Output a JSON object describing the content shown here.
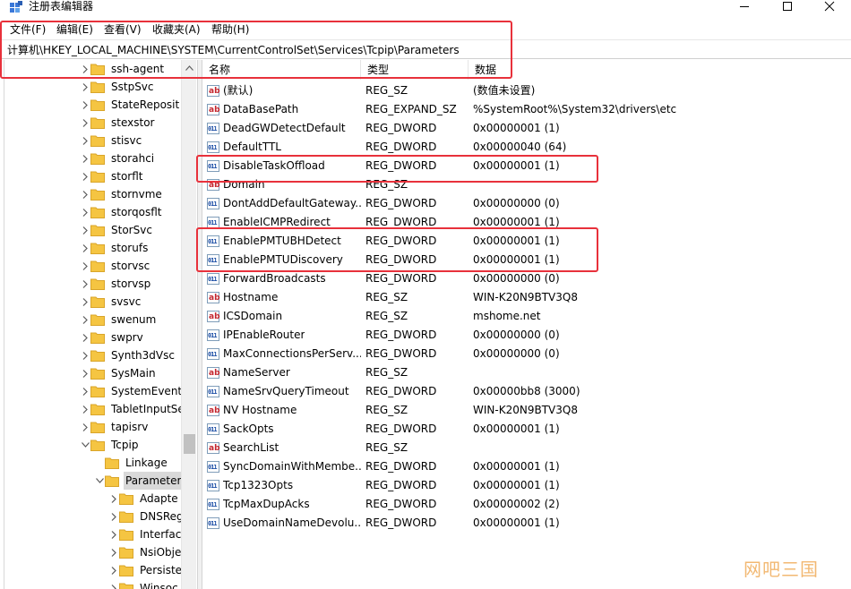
{
  "window": {
    "title": "注册表编辑器",
    "controls": [
      "minimize-icon",
      "maximize-icon",
      "close-icon"
    ]
  },
  "menu": [
    {
      "label": "文件(F)"
    },
    {
      "label": "编辑(E)"
    },
    {
      "label": "查看(V)"
    },
    {
      "label": "收藏夹(A)"
    },
    {
      "label": "帮助(H)"
    }
  ],
  "address": {
    "path": "计算机\\HKEY_LOCAL_MACHINE\\SYSTEM\\CurrentControlSet\\Services\\Tcpip\\Parameters"
  },
  "tree": {
    "items": [
      {
        "label": "ssh-agent"
      },
      {
        "label": "SstpSvc"
      },
      {
        "label": "StateReposit"
      },
      {
        "label": "stexstor"
      },
      {
        "label": "stisvc"
      },
      {
        "label": "storahci"
      },
      {
        "label": "storflt"
      },
      {
        "label": "stornvme"
      },
      {
        "label": "storqosflt"
      },
      {
        "label": "StorSvc"
      },
      {
        "label": "storufs"
      },
      {
        "label": "storvsc"
      },
      {
        "label": "storvsp"
      },
      {
        "label": "svsvc"
      },
      {
        "label": "swenum"
      },
      {
        "label": "swprv"
      },
      {
        "label": "Synth3dVsc"
      },
      {
        "label": "SysMain"
      },
      {
        "label": "SystemEvents"
      },
      {
        "label": "TabletInputSe"
      },
      {
        "label": "tapisrv"
      },
      {
        "label": "Tcpip"
      },
      {
        "label": "Linkage"
      },
      {
        "label": "Parameters"
      },
      {
        "label": "Adapte"
      },
      {
        "label": "DNSReg"
      },
      {
        "label": "Interfac"
      },
      {
        "label": "NsiObje"
      },
      {
        "label": "Persiste"
      },
      {
        "label": "Winsoc"
      }
    ]
  },
  "list": {
    "columns": {
      "name": "名称",
      "type": "类型",
      "data": "数据"
    },
    "rows": [
      {
        "icon": "sz",
        "name": "(默认)",
        "type": "REG_SZ",
        "data": "(数值未设置)"
      },
      {
        "icon": "sz",
        "name": "DataBasePath",
        "type": "REG_EXPAND_SZ",
        "data": "%SystemRoot%\\System32\\drivers\\etc"
      },
      {
        "icon": "dw",
        "name": "DeadGWDetectDefault",
        "type": "REG_DWORD",
        "data": "0x00000001 (1)"
      },
      {
        "icon": "dw",
        "name": "DefaultTTL",
        "type": "REG_DWORD",
        "data": "0x00000040 (64)"
      },
      {
        "icon": "dw",
        "name": "DisableTaskOffload",
        "type": "REG_DWORD",
        "data": "0x00000001 (1)"
      },
      {
        "icon": "sz",
        "name": "Domain",
        "type": "REG_SZ",
        "data": ""
      },
      {
        "icon": "dw",
        "name": "DontAddDefaultGateway...",
        "type": "REG_DWORD",
        "data": "0x00000000 (0)"
      },
      {
        "icon": "dw",
        "name": "EnableICMPRedirect",
        "type": "REG_DWORD",
        "data": "0x00000001 (1)"
      },
      {
        "icon": "dw",
        "name": "EnablePMTUBHDetect",
        "type": "REG_DWORD",
        "data": "0x00000001 (1)"
      },
      {
        "icon": "dw",
        "name": "EnablePMTUDiscovery",
        "type": "REG_DWORD",
        "data": "0x00000001 (1)"
      },
      {
        "icon": "dw",
        "name": "ForwardBroadcasts",
        "type": "REG_DWORD",
        "data": "0x00000000 (0)"
      },
      {
        "icon": "sz",
        "name": "Hostname",
        "type": "REG_SZ",
        "data": "WIN-K20N9BTV3Q8"
      },
      {
        "icon": "sz",
        "name": "ICSDomain",
        "type": "REG_SZ",
        "data": "mshome.net"
      },
      {
        "icon": "dw",
        "name": "IPEnableRouter",
        "type": "REG_DWORD",
        "data": "0x00000000 (0)"
      },
      {
        "icon": "dw",
        "name": "MaxConnectionsPerServ...",
        "type": "REG_DWORD",
        "data": "0x00000000 (0)"
      },
      {
        "icon": "sz",
        "name": "NameServer",
        "type": "REG_SZ",
        "data": ""
      },
      {
        "icon": "dw",
        "name": "NameSrvQueryTimeout",
        "type": "REG_DWORD",
        "data": "0x00000bb8 (3000)"
      },
      {
        "icon": "sz",
        "name": "NV Hostname",
        "type": "REG_SZ",
        "data": "WIN-K20N9BTV3Q8"
      },
      {
        "icon": "dw",
        "name": "SackOpts",
        "type": "REG_DWORD",
        "data": "0x00000001 (1)"
      },
      {
        "icon": "sz",
        "name": "SearchList",
        "type": "REG_SZ",
        "data": ""
      },
      {
        "icon": "dw",
        "name": "SyncDomainWithMembe...",
        "type": "REG_DWORD",
        "data": "0x00000001 (1)"
      },
      {
        "icon": "dw",
        "name": "Tcp1323Opts",
        "type": "REG_DWORD",
        "data": "0x00000001 (1)"
      },
      {
        "icon": "dw",
        "name": "TcpMaxDupAcks",
        "type": "REG_DWORD",
        "data": "0x00000002 (2)"
      },
      {
        "icon": "dw",
        "name": "UseDomainNameDevolu...",
        "type": "REG_DWORD",
        "data": "0x00000001 (1)"
      }
    ]
  },
  "watermark": "网吧三国",
  "colors": {
    "highlight": "#e8313b",
    "folder": "#f5c542",
    "selection": "#d9d9d9",
    "watermark": "#f2b56b"
  }
}
